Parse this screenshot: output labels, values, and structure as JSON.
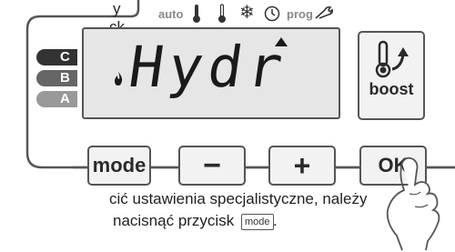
{
  "manual_text": {
    "top_fragment_1": "y",
    "top_fragment_2": "ck",
    "instruction_line_1": "cić ustawienia specjalistyczne, należy",
    "instruction_line_2": "nacisnąć przycisk",
    "inline_button_label": "mode",
    "instruction_end": "."
  },
  "icon_bar": {
    "auto_label": "auto",
    "prog_label": "prog",
    "icons": [
      "thermometer-icon",
      "thermometer-low-icon",
      "snowflake-icon",
      "clock-icon",
      "wrench-icon"
    ]
  },
  "display": {
    "text": "Hydr",
    "flame_icon": "flame-icon",
    "pointer_icon": "triangle-up-icon"
  },
  "level_tabs": [
    {
      "label": "C",
      "color": "#333333"
    },
    {
      "label": "B",
      "color": "#666666"
    },
    {
      "label": "A",
      "color": "#999999"
    }
  ],
  "buttons": {
    "mode": "mode",
    "minus": "−",
    "plus": "+",
    "ok": "OK",
    "boost": "boost"
  },
  "colors": {
    "outline": "#555555",
    "button_bg": "#f2f2f2",
    "display_bg": "#e6e6e6",
    "segment": "#1a1a1a"
  }
}
